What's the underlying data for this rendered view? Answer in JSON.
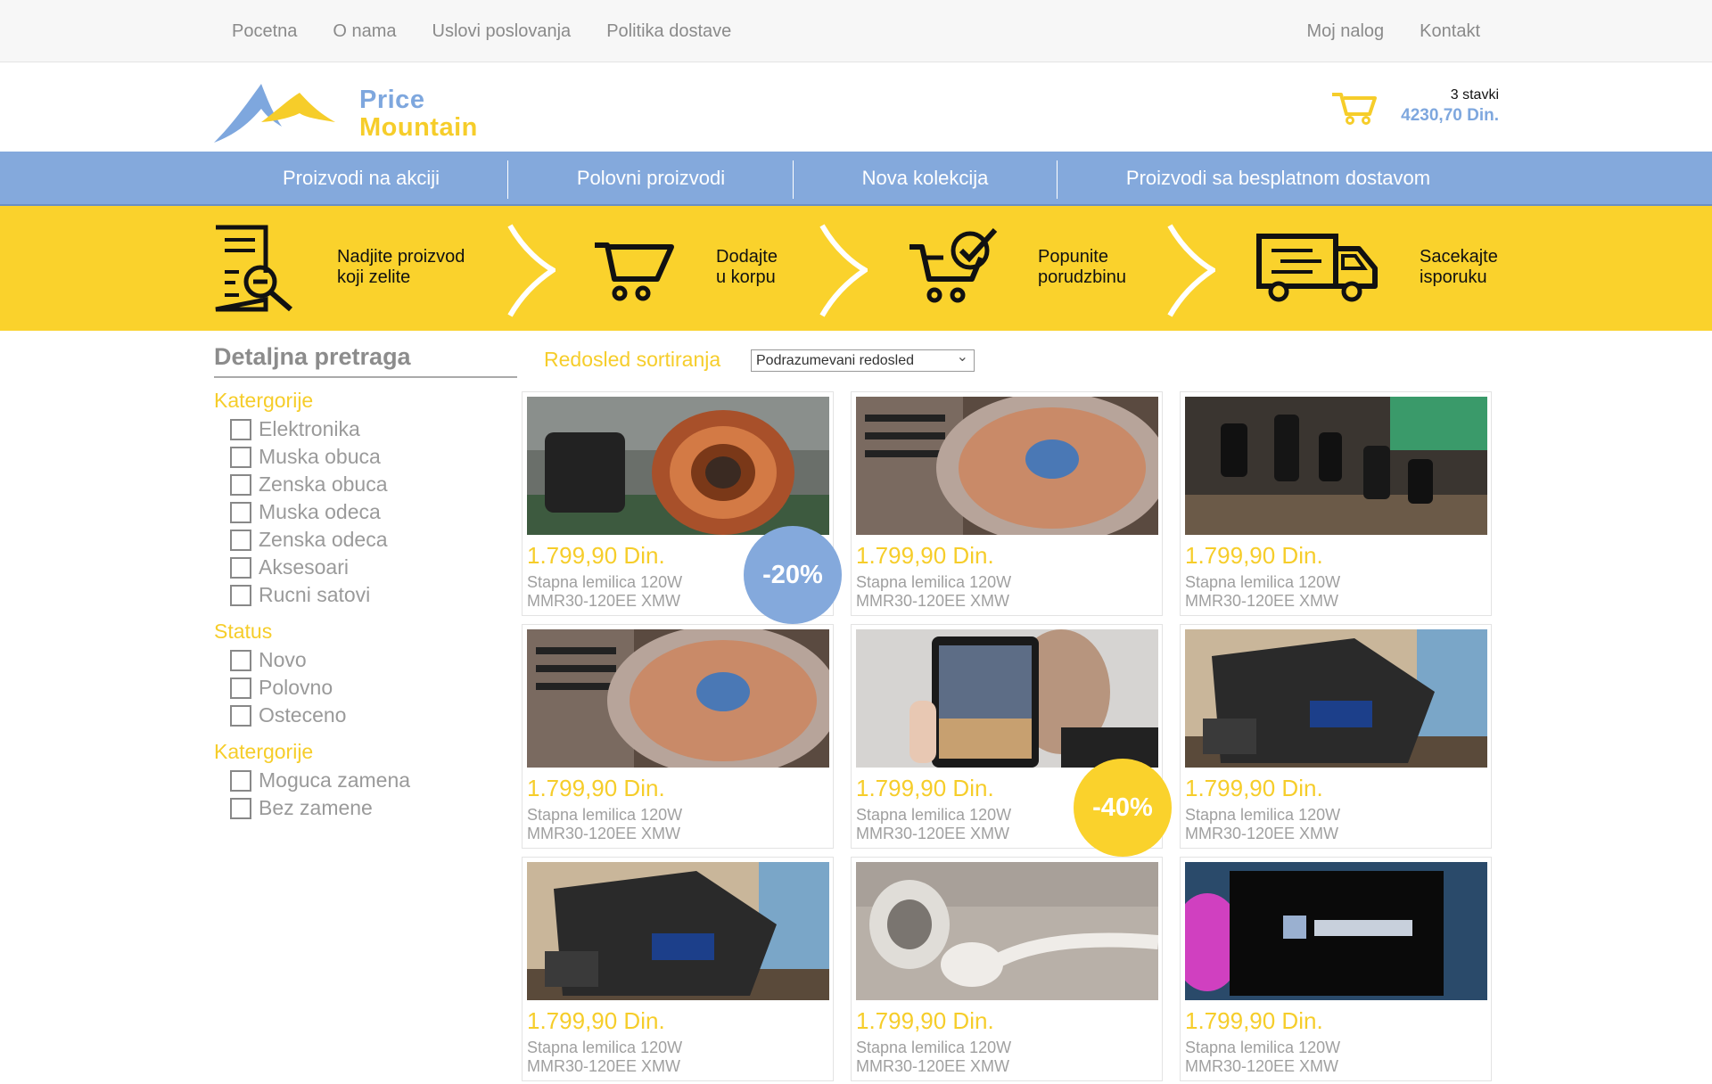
{
  "top_nav": {
    "left": [
      "Pocetna",
      "O nama",
      "Uslovi poslovanja",
      "Politika dostave"
    ],
    "right": [
      "Moj nalog",
      "Kontakt"
    ]
  },
  "logo": {
    "line1": "Price",
    "line2": "Mountain"
  },
  "cart": {
    "count": "3 stavki",
    "total": "4230,70 Din.",
    "icon": "shopping-cart-icon"
  },
  "main_nav": [
    "Proizvodi na akciji",
    "Polovni proizvodi",
    "Nova kolekcija",
    "Proizvodi sa besplatnom dostavom"
  ],
  "steps": [
    {
      "l1": "Nadjite proizvod",
      "l2": "koji zelite",
      "icon": "document-search-icon"
    },
    {
      "l1": "Dodajte",
      "l2": "u korpu",
      "icon": "cart-icon"
    },
    {
      "l1": "Popunite",
      "l2": "porudzbinu",
      "icon": "cart-check-icon"
    },
    {
      "l1": "Sacekajte",
      "l2": "isporuku",
      "icon": "delivery-truck-icon"
    }
  ],
  "sidebar": {
    "title": "Detaljna pretraga",
    "groups": [
      {
        "title": "Katergorije",
        "items": [
          "Elektronika",
          "Muska obuca",
          "Zenska obuca",
          "Muska odeca",
          "Zenska odeca",
          "Aksesoari",
          "Rucni satovi"
        ]
      },
      {
        "title": "Status",
        "items": [
          "Novo",
          "Polovno",
          "Osteceno"
        ]
      },
      {
        "title": "Katergorije",
        "items": [
          "Moguca zamena",
          "Bez zamene"
        ]
      }
    ]
  },
  "sort": {
    "label": "Redosled sortiranja",
    "selected": "Podrazumevani redosled"
  },
  "products": [
    {
      "price": "1.799,90 Din.",
      "name1": "Stapna lemilica 120W",
      "name2": "MMR30-120EE XMW",
      "badge": "-20%",
      "image": "copper-coil-inductor"
    },
    {
      "price": "1.799,90 Din.",
      "name1": "Stapna lemilica 120W",
      "name2": "MMR30-120EE XMW",
      "badge": "",
      "image": "dj-turntable"
    },
    {
      "price": "1.799,90 Din.",
      "name1": "Stapna lemilica 120W",
      "name2": "MMR30-120EE XMW",
      "badge": "",
      "image": "circuit-board-capacitors"
    },
    {
      "price": "1.799,90 Din.",
      "name1": "Stapna lemilica 120W",
      "name2": "MMR30-120EE XMW",
      "badge": "",
      "image": "dj-turntable"
    },
    {
      "price": "1.799,90 Din.",
      "name1": "Stapna lemilica 120W",
      "name2": "MMR30-120EE XMW",
      "badge": "-40%",
      "image": "tablet-held-by-man"
    },
    {
      "price": "1.799,90 Din.",
      "name1": "Stapna lemilica 120W",
      "name2": "MMR30-120EE XMW",
      "badge": "",
      "image": "sony-walkman-player"
    },
    {
      "price": "1.799,90 Din.",
      "name1": "Stapna lemilica 120W",
      "name2": "MMR30-120EE XMW",
      "badge": "",
      "image": "sony-walkman-player"
    },
    {
      "price": "1.799,90 Din.",
      "name1": "Stapna lemilica 120W",
      "name2": "MMR30-120EE XMW",
      "badge": "",
      "image": "earbud-headphones"
    },
    {
      "price": "1.799,90 Din.",
      "name1": "Stapna lemilica 120W",
      "name2": "MMR30-120EE XMW",
      "badge": "",
      "image": "led-tv-screen"
    }
  ],
  "colors": {
    "blue": "#84a9dc",
    "yellow": "#fad22c",
    "grey": "#9a9a9a"
  }
}
